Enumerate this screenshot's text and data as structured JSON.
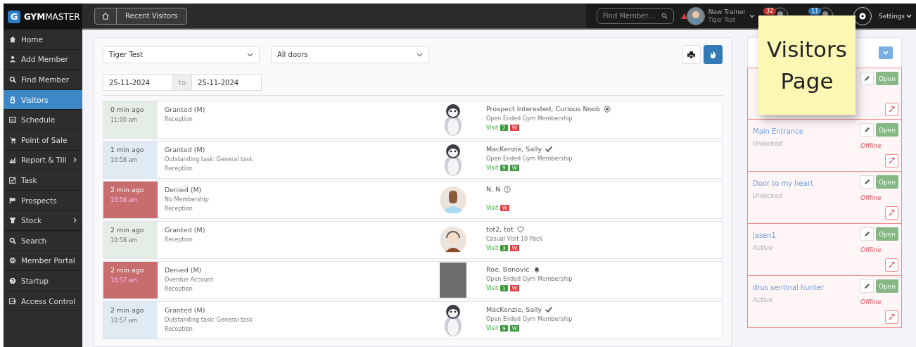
{
  "brand": {
    "name_bold": "GYM",
    "name_rest": "MASTER",
    "letter": "G"
  },
  "breadcrumb": {
    "current": "Recent Visitors"
  },
  "topbar": {
    "search_placeholder": "Find Member...",
    "user_name": "New Trainer",
    "user_club": "Tiger Test",
    "badges": [
      {
        "count": "32",
        "color": "#c9302c"
      },
      {
        "count": "11",
        "color": "#2a7ab8"
      }
    ],
    "settings": "Settings"
  },
  "sidebar": {
    "items": [
      {
        "label": "Home",
        "selected": false,
        "submenu": false
      },
      {
        "label": "Add Member",
        "selected": false,
        "submenu": false
      },
      {
        "label": "Find Member",
        "selected": false,
        "submenu": false
      },
      {
        "label": "Visitors",
        "selected": true,
        "submenu": false
      },
      {
        "label": "Schedule",
        "selected": false,
        "submenu": false
      },
      {
        "label": "Point of Sale",
        "selected": false,
        "submenu": false
      },
      {
        "label": "Report & Till",
        "selected": false,
        "submenu": true
      },
      {
        "label": "Task",
        "selected": false,
        "submenu": false
      },
      {
        "label": "Prospects",
        "selected": false,
        "submenu": false
      },
      {
        "label": "Stock",
        "selected": false,
        "submenu": true
      },
      {
        "label": "Search",
        "selected": false,
        "submenu": false
      },
      {
        "label": "Member Portal",
        "selected": false,
        "submenu": false
      },
      {
        "label": "Startup",
        "selected": false,
        "submenu": false
      },
      {
        "label": "Access Control",
        "selected": false,
        "submenu": false
      }
    ]
  },
  "filters": {
    "club": "Tiger Test",
    "door": "All doors",
    "date_from": "25-11-2024",
    "date_sep": "to",
    "date_to": "25-11-2024"
  },
  "visits": [
    {
      "kind": "granted",
      "ago": "0 min ago",
      "time": "11:00 am",
      "result": "Granted (M)",
      "notes": [
        "Reception"
      ],
      "name": "Prospect Interested, Curious Noob",
      "membership": "Open Ended Gym Membership",
      "visit_label": "Visit",
      "tags": [
        {
          "text": "2",
          "kind": "ok"
        },
        {
          "text": "W",
          "kind": "bad"
        }
      ]
    },
    {
      "kind": "task",
      "ago": "1 min ago",
      "time": "10:58 am",
      "result": "Granted (M)",
      "notes": [
        "Outstanding task: General task",
        "Reception"
      ],
      "name": "MacKenzie, Sally",
      "membership": "Open Ended Gym Membership",
      "visit_label": "Visit",
      "tags": [
        {
          "text": "9",
          "kind": "ok"
        },
        {
          "text": "W",
          "kind": "ok"
        }
      ]
    },
    {
      "kind": "denied",
      "ago": "2 min ago",
      "time": "10:58 am",
      "result": "Denied (M)",
      "notes": [
        "No Membership",
        "Reception"
      ],
      "name": "N, N",
      "visit_label": "Visit",
      "tags": [
        {
          "text": "W",
          "kind": "bad"
        }
      ]
    },
    {
      "kind": "granted",
      "ago": "2 min ago",
      "time": "10:58 am",
      "result": "Granted (M)",
      "notes": [
        "Reception"
      ],
      "name": "tot2, tot",
      "membership": "Casual Visit 10 Pack",
      "visit_label": "Visit",
      "tags": [
        {
          "text": "3",
          "kind": "ok"
        },
        {
          "text": "W",
          "kind": "bad"
        }
      ]
    },
    {
      "kind": "denied",
      "ago": "2 min ago",
      "time": "10:57 am",
      "result": "Denied (M)",
      "notes": [
        "Overdue Account",
        "Reception"
      ],
      "name": "Roe, Bonovic",
      "membership": "Open Ended Gym Membership",
      "visit_label": "Visit",
      "tags": [
        {
          "text": "1",
          "kind": "ok"
        },
        {
          "text": "W",
          "kind": "bad"
        }
      ]
    },
    {
      "kind": "task",
      "ago": "2 min ago",
      "time": "10:57 am",
      "result": "Granted (M)",
      "notes": [
        "Outstanding task: General task",
        "Reception"
      ],
      "name": "MacKenzie, Sally",
      "membership": "Open Ended Gym Membership",
      "visit_label": "Visit",
      "tags": [
        {
          "text": "9",
          "kind": "ok"
        },
        {
          "text": "W",
          "kind": "ok"
        }
      ]
    }
  ],
  "doors": [
    {
      "open_label": "Open"
    },
    {
      "name": "Main Entrance",
      "state": "Unlocked",
      "status": "Offline",
      "open_label": "Open"
    },
    {
      "name": "Door to my heart",
      "state": "Unlocked",
      "status": "Offline",
      "open_label": "Open"
    },
    {
      "name": "jasen1",
      "state": "Active",
      "status": "Offline",
      "open_label": "Open"
    },
    {
      "name": "drus sentinal hunter",
      "state": "Active",
      "status": "Offline",
      "open_label": "Open"
    }
  ],
  "sticky_note": {
    "text": "Visitors Page"
  }
}
